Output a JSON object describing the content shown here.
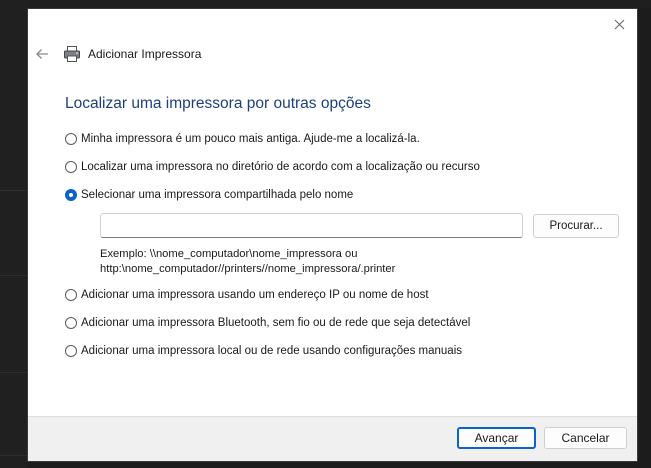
{
  "window": {
    "title": "Adicionar Impressora",
    "close_icon": "close-icon",
    "back_icon": "back-arrow-icon",
    "app_icon": "printer-icon"
  },
  "main": {
    "heading": "Localizar uma impressora por outras opções",
    "options": [
      {
        "label": "Minha impressora é um pouco mais antiga. Ajude-me a localizá-la.",
        "selected": false
      },
      {
        "label": "Localizar uma impressora no diretório de acordo com a localização ou recurso",
        "selected": false
      },
      {
        "label": "Selecionar uma impressora compartilhada pelo nome",
        "selected": true
      },
      {
        "label": "Adicionar uma impressora usando um endereço IP ou nome de host",
        "selected": false
      },
      {
        "label": "Adicionar uma impressora Bluetooth, sem fio ou de rede que seja detectável",
        "selected": false
      },
      {
        "label": "Adicionar uma impressora local ou de rede usando configurações manuais",
        "selected": false
      }
    ],
    "shared_name": {
      "value": "",
      "browse_label": "Procurar...",
      "example_line1": "Exemplo: \\\\nome_computador\\nome_impressora ou",
      "example_line2": "http:\\nome_computador//printers//nome_impressora/.printer"
    }
  },
  "footer": {
    "next_label": "Avançar",
    "cancel_label": "Cancelar"
  },
  "colors": {
    "accent": "#0a63c6",
    "heading": "#1f3f7f"
  }
}
